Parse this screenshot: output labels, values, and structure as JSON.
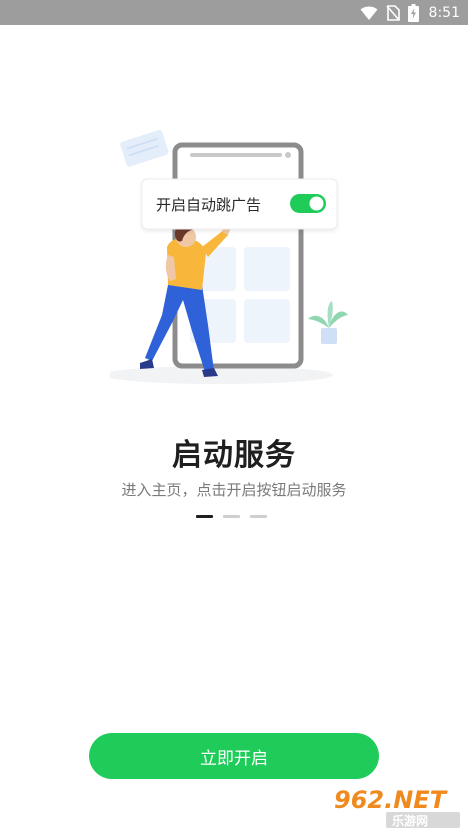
{
  "status_bar": {
    "time": "8:51",
    "icons": [
      "wifi-icon",
      "no-sim-icon",
      "battery-charging-icon"
    ]
  },
  "illustration": {
    "toggle_card_label": "开启自动跳广告",
    "toggle_state": "on",
    "accent_color": "#1fcc5a"
  },
  "onboarding": {
    "title": "启动服务",
    "subtitle": "进入主页，点击开启按钮启动服务",
    "pager": {
      "total": 3,
      "current": 1
    }
  },
  "primary_button": {
    "label": "立即开启"
  },
  "watermark": {
    "top": "962.NET",
    "bottom": "乐游网"
  },
  "colors": {
    "status_bar": "#9d9d9d",
    "brand_green": "#1fcc5a",
    "title": "#1f1f1f",
    "subtitle": "#7a7a7a"
  }
}
